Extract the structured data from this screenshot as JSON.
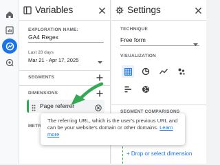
{
  "variables_panel": {
    "title": "Variables",
    "exploration_name_label": "EXPLORATION NAME:",
    "exploration_name": "GA4 Regex",
    "date_preset": "Last 28 days",
    "date_range": "Mar 21 - Apr 17, 2025",
    "segments_label": "SEGMENTS",
    "dimensions_label": "DIMENSIONS",
    "dimension_chip": "Page referrer",
    "metrics_label": "METRI"
  },
  "settings_panel": {
    "title": "Settings",
    "technique_label": "TECHNIQUE",
    "technique_value": "Free form",
    "visualization_label": "VISUALIZATION",
    "segment_comparisons_label": "SEGMENT COMPARISONS",
    "drop_dimension_label": "+ Drop or select dimension"
  },
  "tooltip": {
    "text": "The referring URL, which is the user's previous URL and can be your website's domain or other domains.",
    "link": "Learn more"
  },
  "annotation": {
    "arrow_color": "#34a853"
  },
  "colors": {
    "accent": "#1a73e8",
    "chip_border": "#34a853"
  },
  "icons": [
    "home-icon",
    "reports-icon",
    "explore-icon",
    "advertising-icon",
    "variables-icon",
    "settings-icon",
    "close-icon",
    "drag-handle-icon",
    "remove-circle-icon",
    "table-icon",
    "donut-icon",
    "line-chart-icon",
    "scatter-icon",
    "bar-icon",
    "geo-icon"
  ]
}
